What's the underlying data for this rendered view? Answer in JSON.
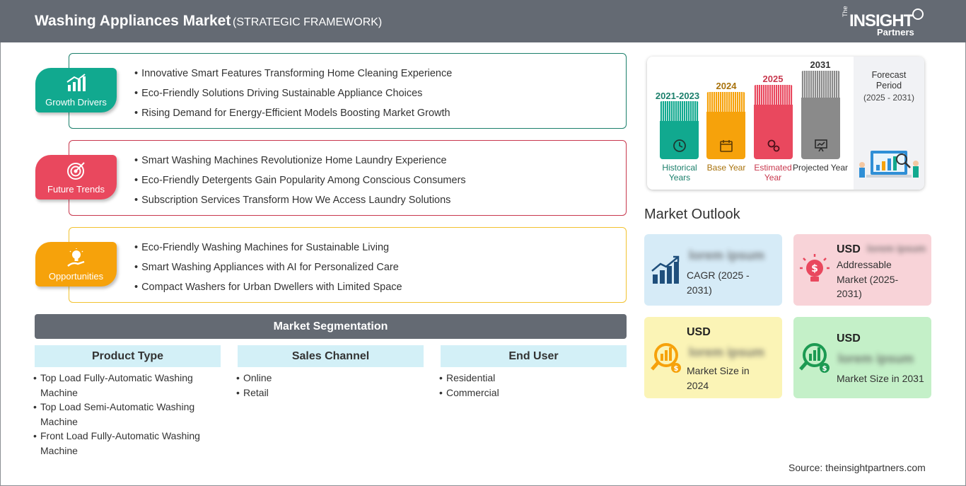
{
  "header": {
    "title": "Washing Appliances Market",
    "subtitle": "(STRATEGIC FRAMEWORK)",
    "logo": {
      "the": "The",
      "insight": "INSIGHT",
      "partners": "Partners"
    }
  },
  "sections": [
    {
      "label": "Growth Drivers",
      "color": "#11a98f",
      "border": "#1b7f6b",
      "icon": "bar-chart-icon",
      "items": [
        "Innovative Smart Features Transforming Home Cleaning Experience",
        "Eco-Friendly Solutions Driving Sustainable Appliance Choices",
        "Rising Demand for Energy-Efficient Models Boosting Market Growth"
      ]
    },
    {
      "label": "Future Trends",
      "color": "#e9485e",
      "border": "#c8384e",
      "icon": "target-icon",
      "items": [
        "Smart Washing Machines Revolutionize Home Laundry Experience",
        "Eco-Friendly Detergents Gain Popularity Among Conscious Consumers",
        "Subscription Services Transform How We Access Laundry Solutions"
      ]
    },
    {
      "label": "Opportunities",
      "color": "#f6a20b",
      "border": "#f2c230",
      "icon": "lightbulb-hand-icon",
      "items": [
        "Eco-Friendly Washing Machines for Sustainable Living",
        "Smart Washing Appliances with AI for Personalized Care",
        "Compact Washers for Urban Dwellers with Limited Space"
      ]
    }
  ],
  "segmentation": {
    "title": "Market Segmentation",
    "columns": [
      {
        "title": "Product Type",
        "items": [
          "Top Load Fully-Automatic Washing Machine",
          "Top Load Semi-Automatic Washing Machine",
          "Front Load Fully-Automatic Washing Machine"
        ]
      },
      {
        "title": "Sales Channel",
        "items": [
          "Online",
          "Retail"
        ]
      },
      {
        "title": "End User",
        "items": [
          "Residential",
          "Commercial"
        ]
      }
    ]
  },
  "timeline": {
    "bars": [
      {
        "year": "2021-2023",
        "label": "Historical Years",
        "color": "#11a98f",
        "yearColor": "#1b7f6b",
        "labelColor": "#1b7f6b",
        "icon": "history-icon"
      },
      {
        "year": "2024",
        "label": "Base Year",
        "color": "#f6a20b",
        "yearColor": "#a8720c",
        "labelColor": "#a8720c",
        "icon": "calendar-icon"
      },
      {
        "year": "2025",
        "label": "Estimated Year",
        "color": "#e9485e",
        "yearColor": "#c8384e",
        "labelColor": "#c8384e",
        "icon": "gears-icon"
      },
      {
        "year": "2031",
        "label": "Projected Year",
        "color": "#8a8a8a",
        "yearColor": "#333333",
        "labelColor": "#333333",
        "icon": "presentation-icon"
      }
    ],
    "forecast": {
      "label": "Forecast Period",
      "years": "(2025 - 2031)"
    }
  },
  "outlook": {
    "title": "Market Outlook",
    "cards": [
      {
        "value": "lorem ipsum",
        "text": "CAGR (2025 - 2031)",
        "color": "#d6ebf7",
        "icon": "growth-chart-icon"
      },
      {
        "usd": "USD",
        "value": "lorem ipsum",
        "text": "Addressable Market (2025-2031)",
        "color": "#f8d3d8",
        "icon": "idea-dollar-icon"
      },
      {
        "usd": "USD",
        "value": "lorem ipsum",
        "text": "Market Size in 2024",
        "color": "#fbf4b6",
        "icon": "money-search-icon"
      },
      {
        "usd": "USD",
        "value": "lorem ipsum",
        "text": "Market Size in 2031",
        "color": "#c4f0c8",
        "icon": "money-search-icon"
      }
    ]
  },
  "source": "Source: theinsightpartners.com"
}
